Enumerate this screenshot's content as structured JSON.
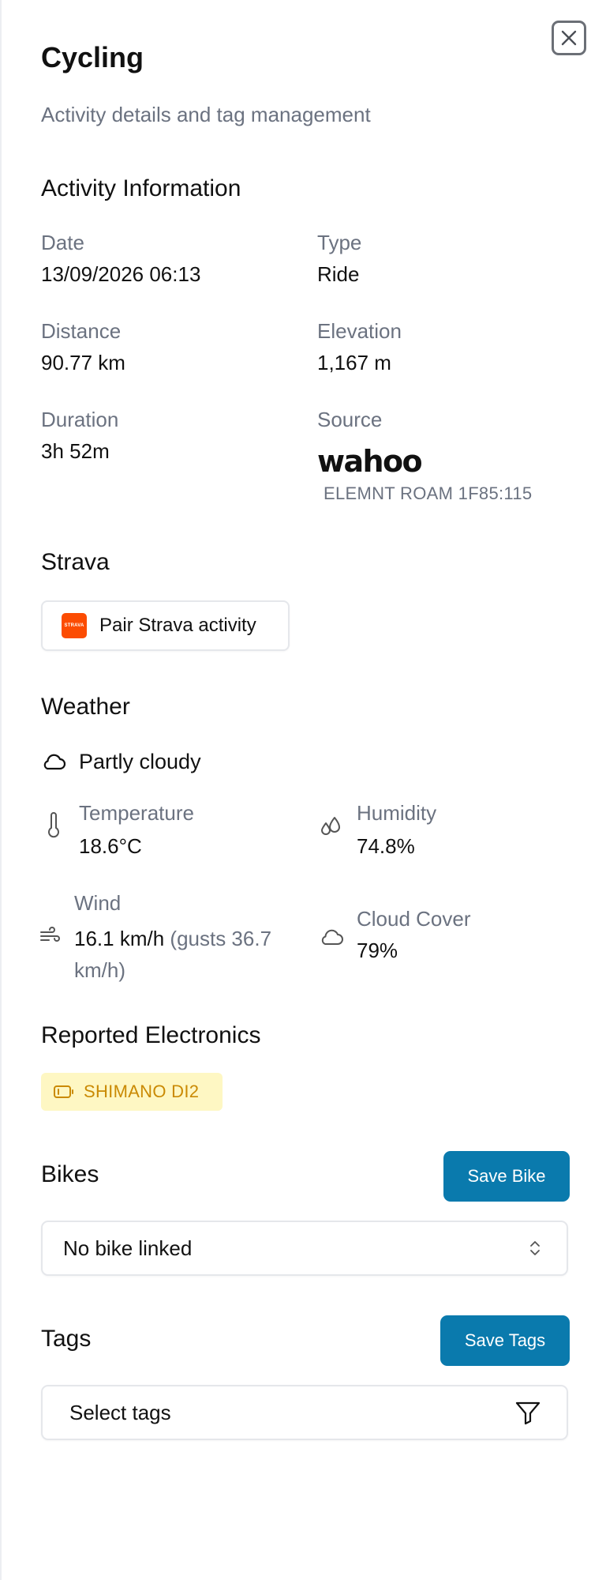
{
  "header": {
    "title": "Cycling",
    "subtitle": "Activity details and tag management"
  },
  "activity": {
    "section_title": "Activity Information",
    "date_label": "Date",
    "date_value": "13/09/2026 06:13",
    "type_label": "Type",
    "type_value": "Ride",
    "distance_label": "Distance",
    "distance_value": "90.77 km",
    "elevation_label": "Elevation",
    "elevation_value": "1,167 m",
    "duration_label": "Duration",
    "duration_value": "3h 52m",
    "source_label": "Source",
    "source_brand": "wahoo",
    "source_device": "ELEMNT ROAM 1F85:115"
  },
  "strava": {
    "section_title": "Strava",
    "logo_text": "STRAVA",
    "pair_label": "Pair Strava activity"
  },
  "weather": {
    "section_title": "Weather",
    "condition": "Partly cloudy",
    "temperature_label": "Temperature",
    "temperature_value": "18.6°C",
    "humidity_label": "Humidity",
    "humidity_value": "74.8%",
    "wind_label": "Wind",
    "wind_value": "16.1 km/h",
    "wind_gusts_line1": "(gusts 36.7",
    "wind_gusts_line2": "km/h)",
    "cloud_label": "Cloud Cover",
    "cloud_value": "79%"
  },
  "electronics": {
    "section_title": "Reported Electronics",
    "badge": "SHIMANO DI2"
  },
  "bikes": {
    "section_title": "Bikes",
    "save_label": "Save Bike",
    "select_value": "No bike linked"
  },
  "tags": {
    "section_title": "Tags",
    "save_label": "Save Tags",
    "select_placeholder": "Select tags"
  },
  "colors": {
    "primary": "#0a7aad",
    "strava": "#fc4c02",
    "badge_bg": "#fef7c3",
    "badge_text": "#ca8a04",
    "muted": "#6b7280"
  },
  "icons": {
    "close": "close-icon",
    "condition": "cloud-icon",
    "temperature": "thermometer-icon",
    "humidity": "droplets-icon",
    "wind": "wind-icon",
    "cloud_cover": "cloud-icon",
    "electronics": "battery-icon",
    "select": "chevrons-up-down-icon",
    "filter": "filter-icon"
  }
}
